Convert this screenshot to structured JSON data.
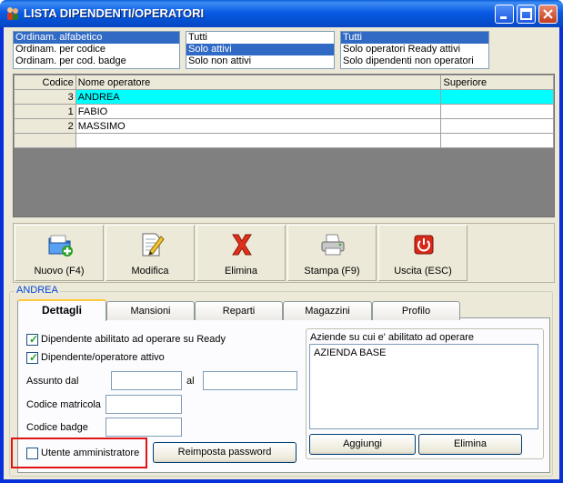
{
  "window": {
    "title": "LISTA DIPENDENTI/OPERATORI",
    "icon": "people-icon"
  },
  "filters": {
    "ordinamento": {
      "options": [
        "Ordinam. alfabetico",
        "Ordinam. per codice",
        "Ordinam. per cod. badge"
      ],
      "selected_index": 0
    },
    "stato": {
      "options": [
        "Tutti",
        "Solo attivi",
        "Solo non attivi"
      ],
      "selected_index": 1
    },
    "tipo": {
      "options": [
        "Tutti",
        "Solo operatori Ready attivi",
        "Solo dipendenti non operatori"
      ],
      "selected_index": 0
    }
  },
  "grid": {
    "headers": {
      "codice": "Codice",
      "nome": "Nome operatore",
      "superiore": "Superiore"
    },
    "rows": [
      {
        "codice": "3",
        "nome": "ANDREA",
        "superiore": ""
      },
      {
        "codice": "1",
        "nome": "FABIO",
        "superiore": ""
      },
      {
        "codice": "2",
        "nome": "MASSIMO",
        "superiore": ""
      },
      {
        "codice": "",
        "nome": "",
        "superiore": ""
      }
    ],
    "active_row": 0
  },
  "toolbar": {
    "nuovo": {
      "label": "Nuovo (F4)",
      "icon": "new-folder-icon"
    },
    "modifica": {
      "label": "Modifica",
      "icon": "edit-document-icon"
    },
    "elimina": {
      "label": "Elimina",
      "icon": "delete-x-icon"
    },
    "stampa": {
      "label": "Stampa (F9)",
      "icon": "printer-icon"
    },
    "uscita": {
      "label": "Uscita (ESC)",
      "icon": "power-icon"
    }
  },
  "detail": {
    "group_title": "ANDREA",
    "tabs": [
      "Dettagli",
      "Mansioni",
      "Reparti",
      "Magazzini",
      "Profilo"
    ],
    "active_tab": 0,
    "abilitato_ready": {
      "label": "Dipendente abilitato ad operare su Ready",
      "checked": true
    },
    "attivo": {
      "label": "Dipendente/operatore attivo",
      "checked": true
    },
    "assunto_dal": {
      "label": "Assunto dal",
      "value": ""
    },
    "assunto_al": {
      "label": "al",
      "value": ""
    },
    "codice_matricola": {
      "label": "Codice matricola",
      "value": ""
    },
    "codice_badge": {
      "label": "Codice badge",
      "value": ""
    },
    "amministratore": {
      "label": "Utente amministratore",
      "checked": false
    },
    "reimposta_password": "Reimposta password",
    "aziende": {
      "title": "Aziende su cui e' abilitato ad operare",
      "items": [
        "AZIENDA BASE"
      ],
      "add_label": "Aggiungi",
      "remove_label": "Elimina"
    }
  },
  "colors": {
    "titlebar": "#0b5be6",
    "selection": "#316ac5",
    "active_row": "#00ffff",
    "highlight_box": "#e01414",
    "group_title": "#0046d5"
  }
}
